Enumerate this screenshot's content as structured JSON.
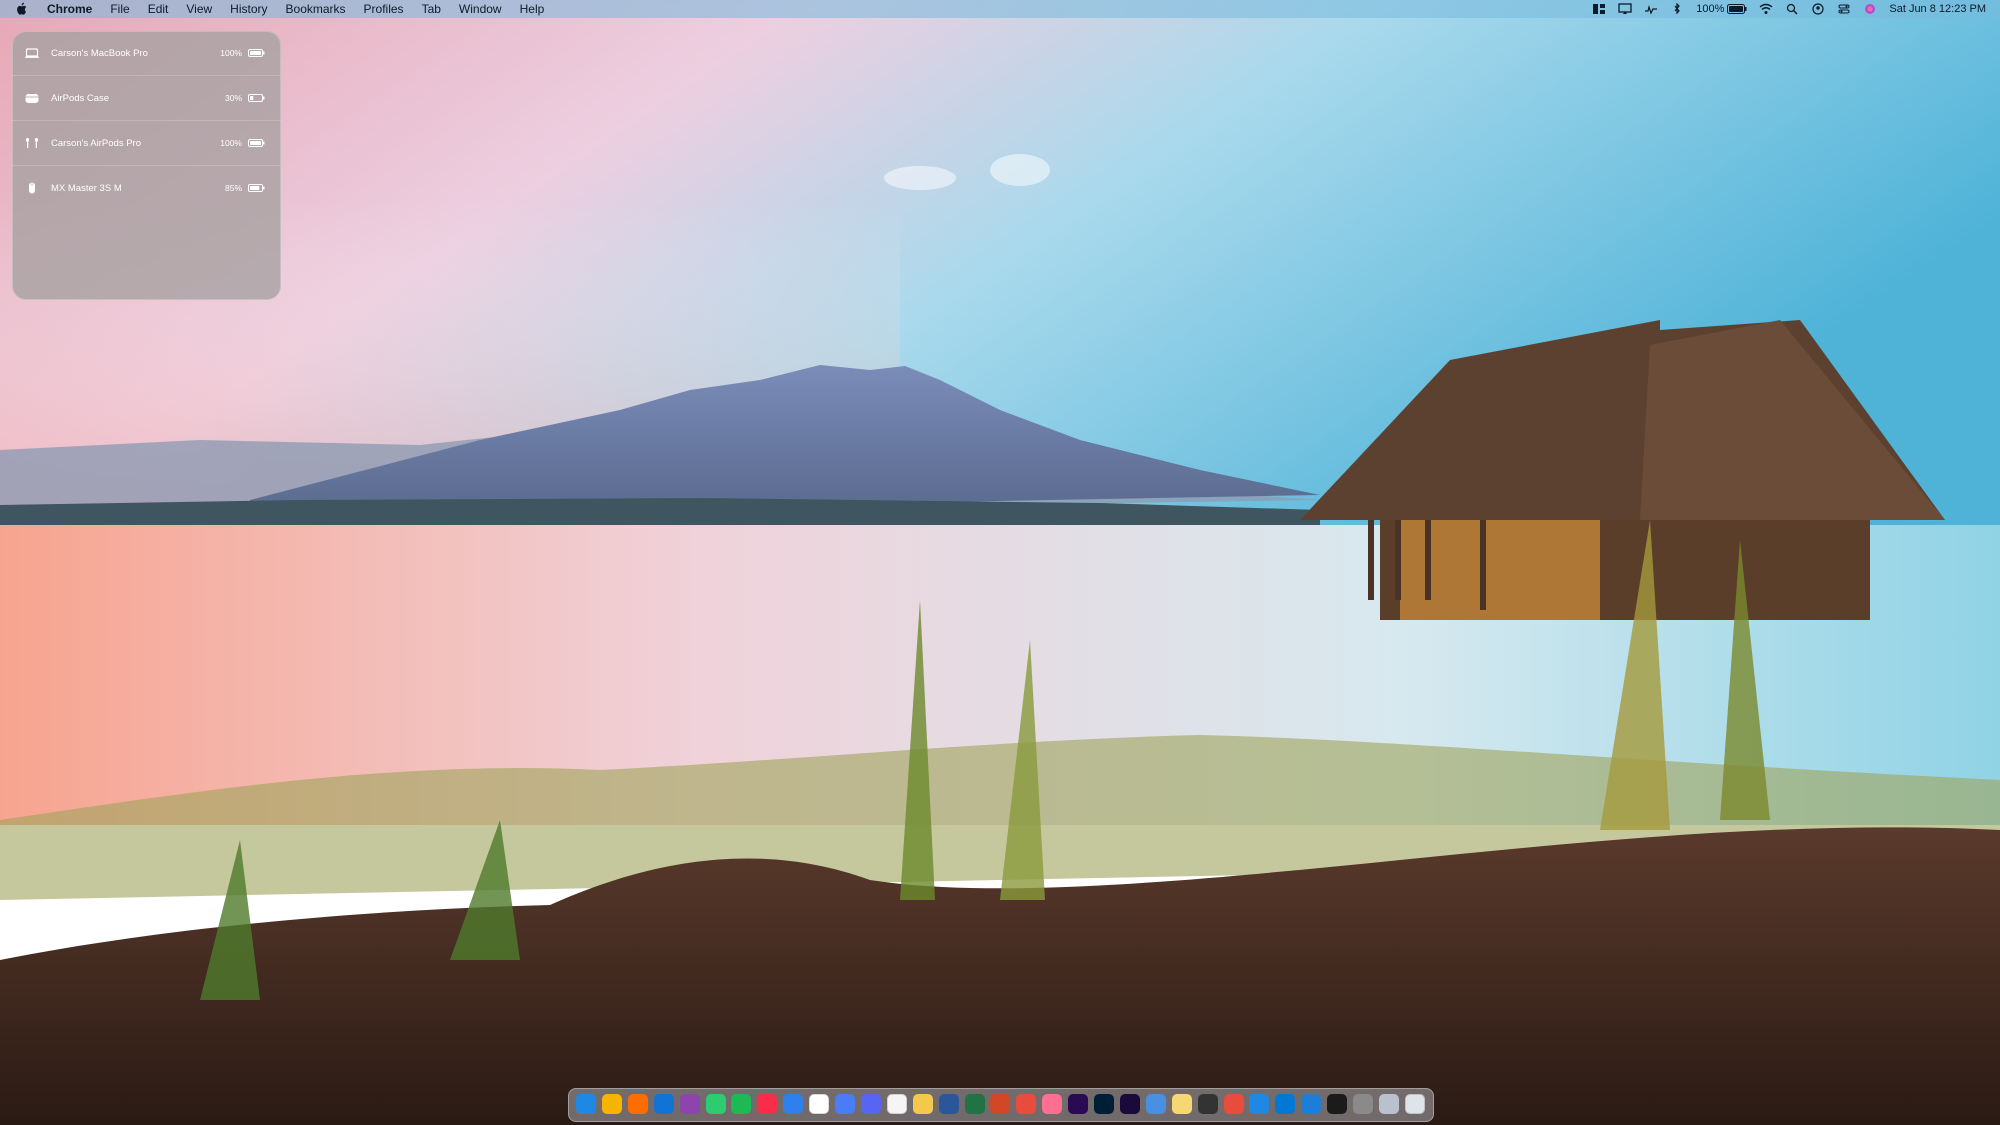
{
  "menubar": {
    "app_name": "Chrome",
    "menus": [
      "File",
      "Edit",
      "View",
      "History",
      "Bookmarks",
      "Profiles",
      "Tab",
      "Window",
      "Help"
    ],
    "battery_percent": "100%",
    "datetime": "Sat Jun 8  12:23 PM"
  },
  "battery_widget": {
    "devices": [
      {
        "name": "Carson's MacBook Pro",
        "percent": "100%",
        "level": 1.0,
        "icon": "laptop-icon"
      },
      {
        "name": "AirPods Case",
        "percent": "30%",
        "level": 0.3,
        "icon": "airpods-case-icon"
      },
      {
        "name": "Carson's AirPods Pro",
        "percent": "100%",
        "level": 1.0,
        "icon": "airpods-icon"
      },
      {
        "name": "MX Master 3S M",
        "percent": "85%",
        "level": 0.85,
        "icon": "mouse-icon"
      }
    ]
  },
  "dock": {
    "apps": [
      {
        "id": "finder",
        "color": "#1e88e5"
      },
      {
        "id": "chrome",
        "color": "#f4b400"
      },
      {
        "id": "firefox",
        "color": "#ff6d00"
      },
      {
        "id": "edge",
        "color": "#1173d4"
      },
      {
        "id": "podcasts",
        "color": "#8e44ad"
      },
      {
        "id": "messages",
        "color": "#2ecc71"
      },
      {
        "id": "spotify",
        "color": "#1db954"
      },
      {
        "id": "music",
        "color": "#fa2d48"
      },
      {
        "id": "mail",
        "color": "#2f80ed"
      },
      {
        "id": "calendar",
        "color": "#ffffff"
      },
      {
        "id": "messenger",
        "color": "#4a7cf7"
      },
      {
        "id": "discord",
        "color": "#5865f2"
      },
      {
        "id": "chatgpt",
        "color": "#f5f5f5"
      },
      {
        "id": "photos",
        "color": "#f2c94c"
      },
      {
        "id": "word",
        "color": "#2b579a"
      },
      {
        "id": "excel",
        "color": "#217346"
      },
      {
        "id": "powerpoint",
        "color": "#d24726"
      },
      {
        "id": "app-18",
        "color": "#e74c3c"
      },
      {
        "id": "app-19",
        "color": "#ff6f91"
      },
      {
        "id": "premiere",
        "color": "#2a0a52"
      },
      {
        "id": "photoshop",
        "color": "#001e36"
      },
      {
        "id": "after-effects",
        "color": "#1a0a3a"
      },
      {
        "id": "app-23",
        "color": "#4a90e2"
      },
      {
        "id": "notes",
        "color": "#f7d774"
      },
      {
        "id": "app-25",
        "color": "#333333"
      },
      {
        "id": "app-26",
        "color": "#e74c3c"
      },
      {
        "id": "app-store",
        "color": "#1e88e5"
      },
      {
        "id": "vscode",
        "color": "#0078d4"
      },
      {
        "id": "xcode",
        "color": "#1c7ed6"
      },
      {
        "id": "terminal",
        "color": "#1b1b1b"
      },
      {
        "id": "settings",
        "color": "#8a8a8a"
      },
      {
        "id": "downloads",
        "color": "#b9c2cc"
      },
      {
        "id": "trash",
        "color": "#dfe4ea"
      }
    ]
  }
}
